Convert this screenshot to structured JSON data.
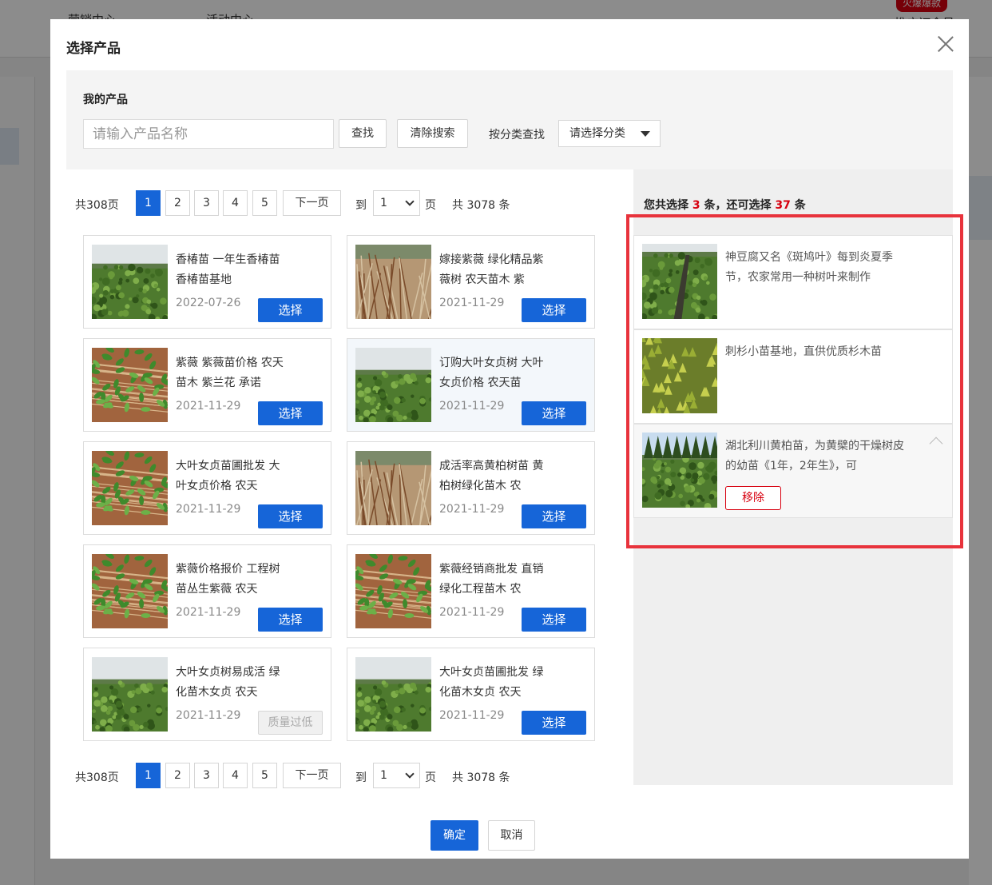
{
  "background": {
    "nav_items": [
      "营销中心",
      "活动中心"
    ],
    "badge": "火爆爆款",
    "right_text": "推广订会员"
  },
  "dialog": {
    "title": "选择产品",
    "search": {
      "label": "我的产品",
      "placeholder": "请输入产品名称",
      "find_button": "查找",
      "clear_button": "清除搜索",
      "category_label": "按分类查找",
      "category_select": "请选择分类"
    },
    "pager": {
      "total_pages": "共308页",
      "pages": [
        "1",
        "2",
        "3",
        "4",
        "5"
      ],
      "active_page": "1",
      "next": "下一页",
      "to": "到",
      "page_select": "1",
      "page_unit": "页",
      "count": "共 3078 条"
    },
    "products": [
      {
        "title": "香椿苗 一年生香椿苗 香椿苗基地",
        "date": "2022-07-26",
        "button": "选择",
        "disabled": false,
        "thumb": "field-sapling"
      },
      {
        "title": "嫁接紫薇 绿化精品紫薇树 农天苗木 紫",
        "date": "2021-11-29",
        "button": "选择",
        "disabled": false,
        "thumb": "bundled-branches"
      },
      {
        "title": "紫薇 紫薇苗价格 农天苗木 紫兰花 承诺",
        "date": "2021-11-29",
        "button": "选择",
        "disabled": false,
        "thumb": "leafy-bundle"
      },
      {
        "title": "订购大叶女贞树 大叶女贞价格 农天苗",
        "date": "2021-11-29",
        "button": "选择",
        "disabled": false,
        "thumb": "open-field"
      },
      {
        "title": "大叶女贞苗圃批发 大叶女贞价格 农天",
        "date": "2021-11-29",
        "button": "选择",
        "disabled": false,
        "thumb": "leafy-branches"
      },
      {
        "title": "成活率高黄柏树苗 黄柏树绿化苗木 农",
        "date": "2021-11-29",
        "button": "选择",
        "disabled": false,
        "thumb": "bare-branches"
      },
      {
        "title": "紫薇价格报价 工程树苗丛生紫薇 农天",
        "date": "2021-11-29",
        "button": "选择",
        "disabled": false,
        "thumb": "leafy-bundle"
      },
      {
        "title": "紫薇经销商批发 直销绿化工程苗木 农",
        "date": "2021-11-29",
        "button": "选择",
        "disabled": false,
        "thumb": "leafy-bundle"
      },
      {
        "title": "大叶女贞树易成活 绿化苗木女贞 农天",
        "date": "2021-11-29",
        "button": "质量过低",
        "disabled": true,
        "thumb": "open-field"
      },
      {
        "title": "大叶女贞苗圃批发 绿化苗木女贞 农天",
        "date": "2021-11-29",
        "button": "选择",
        "disabled": false,
        "thumb": "open-field"
      }
    ],
    "selection": {
      "prefix": "您共选择",
      "selected": "3",
      "middle": "条，还可选择",
      "remaining": "37",
      "suffix": "条",
      "items": [
        {
          "text": "神豆腐又名《斑鸠叶》每到炎夏季节，农家常用一种树叶来制作",
          "thumb": "hillside-crop"
        },
        {
          "text": "刺杉小苗基地，直供优质杉木苗",
          "thumb": "conifer-seedlings"
        },
        {
          "text": "湖北利川黄柏苗，为黄檗的干燥树皮的幼苗《1年，2年生》，可",
          "thumb": "forest-field",
          "remove": "移除"
        }
      ]
    },
    "footer": {
      "ok": "确定",
      "cancel": "取消"
    }
  },
  "colors": {
    "primary": "#1665d8",
    "danger": "#d7000f",
    "highlight": "#e8333c"
  }
}
